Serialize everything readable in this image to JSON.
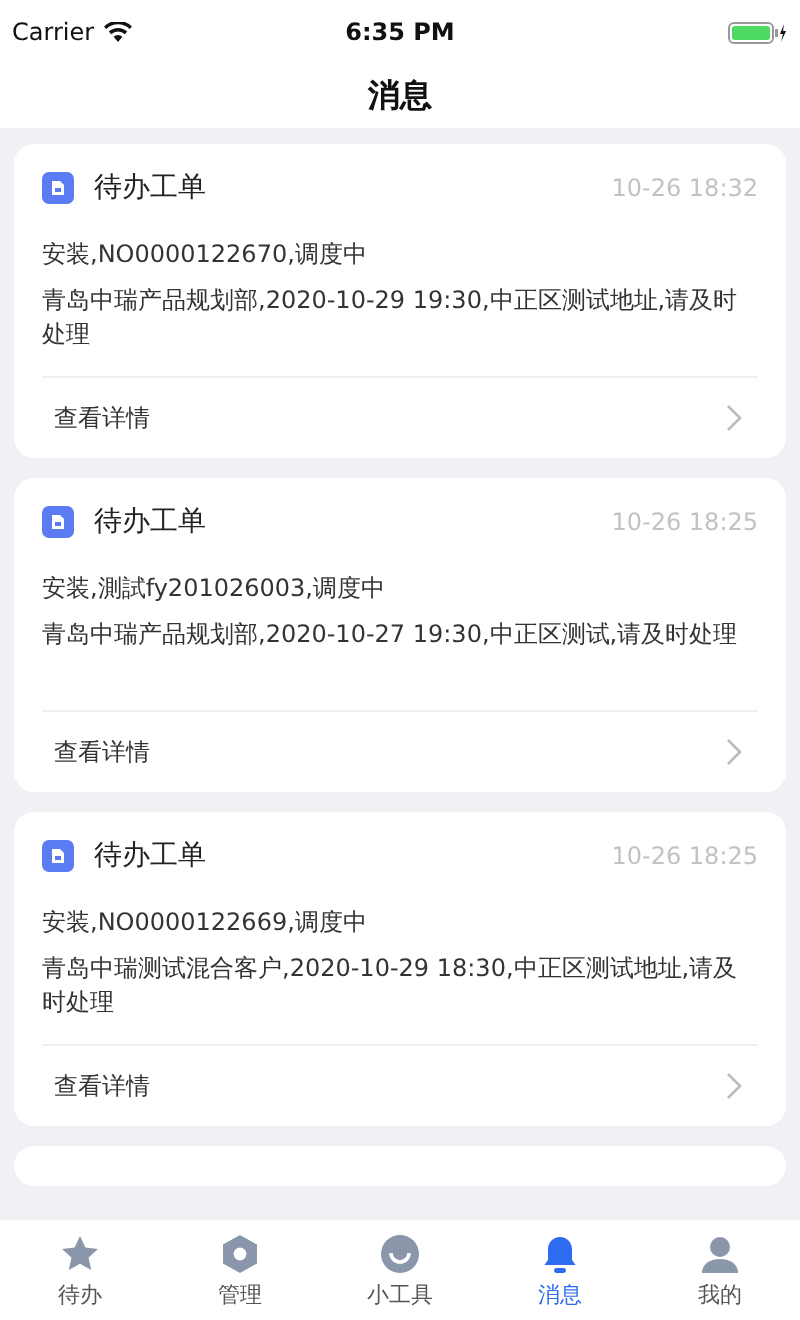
{
  "status_bar": {
    "carrier": "Carrier",
    "time": "6:35 PM"
  },
  "title": "消息",
  "messages": [
    {
      "title": "待办工单",
      "time": "10-26 18:32",
      "summary": "安装,NO0000122670,调度中",
      "detail": "青岛中瑞产品规划部,2020-10-29 19:30,中正区测试地址,请及时处理",
      "action": "查看详情"
    },
    {
      "title": "待办工单",
      "time": "10-26 18:25",
      "summary": "安装,測試fy201026003,调度中",
      "detail": "青岛中瑞产品规划部,2020-10-27 19:30,中正区测试,请及时处理",
      "action": "查看详情"
    },
    {
      "title": "待办工单",
      "time": "10-26 18:25",
      "summary": "安装,NO0000122669,调度中",
      "detail": "青岛中瑞测试混合客户,2020-10-29 18:30,中正区测试地址,请及时处理",
      "action": "查看详情"
    }
  ],
  "tabs": [
    {
      "label": "待办",
      "kind": "star",
      "selected": false
    },
    {
      "label": "管理",
      "kind": "manage",
      "selected": false
    },
    {
      "label": "小工具",
      "kind": "tools",
      "selected": false
    },
    {
      "label": "消息",
      "kind": "bell",
      "selected": true
    },
    {
      "label": "我的",
      "kind": "person",
      "selected": false
    }
  ]
}
